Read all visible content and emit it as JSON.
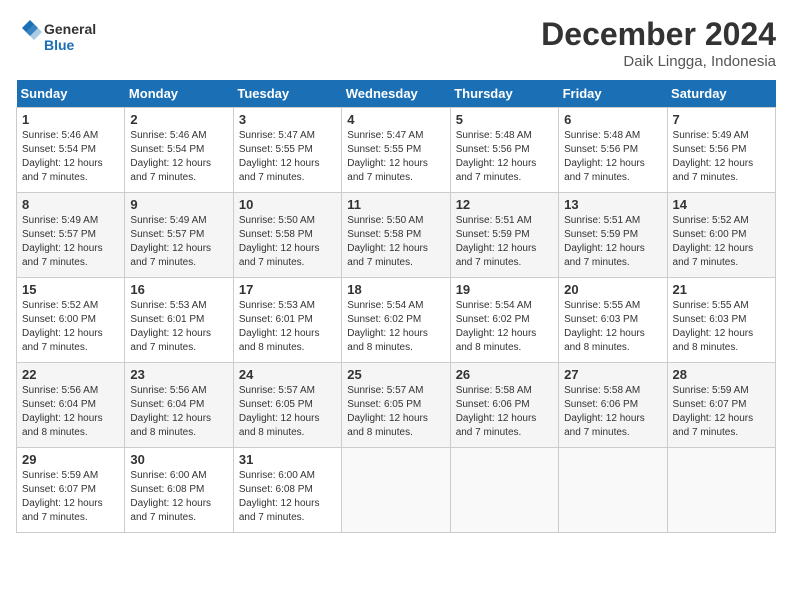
{
  "header": {
    "logo_line1": "General",
    "logo_line2": "Blue",
    "title": "December 2024",
    "subtitle": "Daik Lingga, Indonesia"
  },
  "columns": [
    "Sunday",
    "Monday",
    "Tuesday",
    "Wednesday",
    "Thursday",
    "Friday",
    "Saturday"
  ],
  "weeks": [
    [
      {
        "day": "1",
        "info": "Sunrise: 5:46 AM\nSunset: 5:54 PM\nDaylight: 12 hours\nand 7 minutes."
      },
      {
        "day": "2",
        "info": "Sunrise: 5:46 AM\nSunset: 5:54 PM\nDaylight: 12 hours\nand 7 minutes."
      },
      {
        "day": "3",
        "info": "Sunrise: 5:47 AM\nSunset: 5:55 PM\nDaylight: 12 hours\nand 7 minutes."
      },
      {
        "day": "4",
        "info": "Sunrise: 5:47 AM\nSunset: 5:55 PM\nDaylight: 12 hours\nand 7 minutes."
      },
      {
        "day": "5",
        "info": "Sunrise: 5:48 AM\nSunset: 5:56 PM\nDaylight: 12 hours\nand 7 minutes."
      },
      {
        "day": "6",
        "info": "Sunrise: 5:48 AM\nSunset: 5:56 PM\nDaylight: 12 hours\nand 7 minutes."
      },
      {
        "day": "7",
        "info": "Sunrise: 5:49 AM\nSunset: 5:56 PM\nDaylight: 12 hours\nand 7 minutes."
      }
    ],
    [
      {
        "day": "8",
        "info": "Sunrise: 5:49 AM\nSunset: 5:57 PM\nDaylight: 12 hours\nand 7 minutes."
      },
      {
        "day": "9",
        "info": "Sunrise: 5:49 AM\nSunset: 5:57 PM\nDaylight: 12 hours\nand 7 minutes."
      },
      {
        "day": "10",
        "info": "Sunrise: 5:50 AM\nSunset: 5:58 PM\nDaylight: 12 hours\nand 7 minutes."
      },
      {
        "day": "11",
        "info": "Sunrise: 5:50 AM\nSunset: 5:58 PM\nDaylight: 12 hours\nand 7 minutes."
      },
      {
        "day": "12",
        "info": "Sunrise: 5:51 AM\nSunset: 5:59 PM\nDaylight: 12 hours\nand 7 minutes."
      },
      {
        "day": "13",
        "info": "Sunrise: 5:51 AM\nSunset: 5:59 PM\nDaylight: 12 hours\nand 7 minutes."
      },
      {
        "day": "14",
        "info": "Sunrise: 5:52 AM\nSunset: 6:00 PM\nDaylight: 12 hours\nand 7 minutes."
      }
    ],
    [
      {
        "day": "15",
        "info": "Sunrise: 5:52 AM\nSunset: 6:00 PM\nDaylight: 12 hours\nand 7 minutes."
      },
      {
        "day": "16",
        "info": "Sunrise: 5:53 AM\nSunset: 6:01 PM\nDaylight: 12 hours\nand 7 minutes."
      },
      {
        "day": "17",
        "info": "Sunrise: 5:53 AM\nSunset: 6:01 PM\nDaylight: 12 hours\nand 8 minutes."
      },
      {
        "day": "18",
        "info": "Sunrise: 5:54 AM\nSunset: 6:02 PM\nDaylight: 12 hours\nand 8 minutes."
      },
      {
        "day": "19",
        "info": "Sunrise: 5:54 AM\nSunset: 6:02 PM\nDaylight: 12 hours\nand 8 minutes."
      },
      {
        "day": "20",
        "info": "Sunrise: 5:55 AM\nSunset: 6:03 PM\nDaylight: 12 hours\nand 8 minutes."
      },
      {
        "day": "21",
        "info": "Sunrise: 5:55 AM\nSunset: 6:03 PM\nDaylight: 12 hours\nand 8 minutes."
      }
    ],
    [
      {
        "day": "22",
        "info": "Sunrise: 5:56 AM\nSunset: 6:04 PM\nDaylight: 12 hours\nand 8 minutes."
      },
      {
        "day": "23",
        "info": "Sunrise: 5:56 AM\nSunset: 6:04 PM\nDaylight: 12 hours\nand 8 minutes."
      },
      {
        "day": "24",
        "info": "Sunrise: 5:57 AM\nSunset: 6:05 PM\nDaylight: 12 hours\nand 8 minutes."
      },
      {
        "day": "25",
        "info": "Sunrise: 5:57 AM\nSunset: 6:05 PM\nDaylight: 12 hours\nand 8 minutes."
      },
      {
        "day": "26",
        "info": "Sunrise: 5:58 AM\nSunset: 6:06 PM\nDaylight: 12 hours\nand 7 minutes."
      },
      {
        "day": "27",
        "info": "Sunrise: 5:58 AM\nSunset: 6:06 PM\nDaylight: 12 hours\nand 7 minutes."
      },
      {
        "day": "28",
        "info": "Sunrise: 5:59 AM\nSunset: 6:07 PM\nDaylight: 12 hours\nand 7 minutes."
      }
    ],
    [
      {
        "day": "29",
        "info": "Sunrise: 5:59 AM\nSunset: 6:07 PM\nDaylight: 12 hours\nand 7 minutes."
      },
      {
        "day": "30",
        "info": "Sunrise: 6:00 AM\nSunset: 6:08 PM\nDaylight: 12 hours\nand 7 minutes."
      },
      {
        "day": "31",
        "info": "Sunrise: 6:00 AM\nSunset: 6:08 PM\nDaylight: 12 hours\nand 7 minutes."
      },
      null,
      null,
      null,
      null
    ]
  ]
}
